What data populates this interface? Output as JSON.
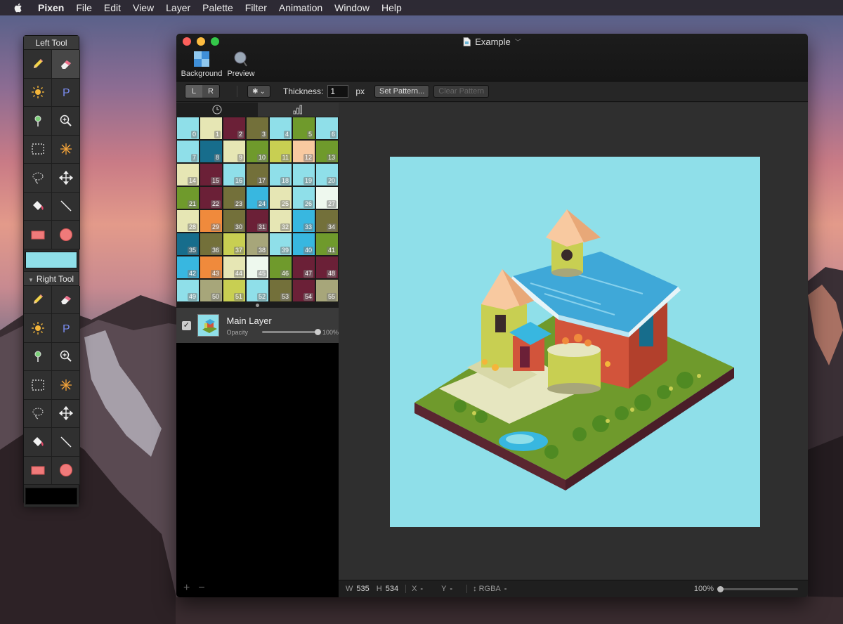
{
  "menubar": {
    "app_name": "Pixen",
    "items": [
      "File",
      "Edit",
      "View",
      "Layer",
      "Palette",
      "Filter",
      "Animation",
      "Window",
      "Help"
    ]
  },
  "tool_panel": {
    "left_title": "Left Tool",
    "right_title": "Right Tool",
    "tools": [
      "pencil-icon",
      "eraser-icon",
      "sun-icon",
      "p-letter-icon",
      "eyedropper-icon",
      "zoom-icon",
      "rect-select-icon",
      "magic-wand-icon",
      "lasso-icon",
      "move-icon",
      "fill-bucket-icon",
      "line-icon",
      "rectangle-icon",
      "ellipse-icon"
    ],
    "left_color": "#8fdfe9",
    "right_color": "#000000"
  },
  "window": {
    "title": "Example",
    "toolbar": {
      "background_label": "Background",
      "preview_label": "Preview"
    },
    "options": {
      "seg_left": "L",
      "seg_right": "R",
      "thickness_label": "Thickness:",
      "thickness_value": "1",
      "thickness_unit": "px",
      "set_pattern": "Set Pattern...",
      "clear_pattern": "Clear Pattern"
    }
  },
  "palette": {
    "colors": [
      "#8fdfe9",
      "#e6e6b4",
      "#6b2037",
      "#73703a",
      "#8fdfe9",
      "#6f9a2c",
      "#8fdfe9",
      "#8fdfe9",
      "#176d8c",
      "#e6e6b4",
      "#6f9a2c",
      "#c8cf52",
      "#f8c9a0",
      "#6f9a2c",
      "#e6e6b4",
      "#6b2037",
      "#8fdfe9",
      "#73703a",
      "#8fdfe9",
      "#8fdfe9",
      "#8fdfe9",
      "#6f9a2c",
      "#6b2037",
      "#73703a",
      "#38b7e0",
      "#e6e6b4",
      "#8fdfe9",
      "#eef8ee",
      "#e6e6b4",
      "#f08a3c",
      "#73703a",
      "#6b2037",
      "#e6e6b4",
      "#38b7e0",
      "#73703a",
      "#176d8c",
      "#73703a",
      "#c8cf52",
      "#a7a67a",
      "#8fdfe9",
      "#38b7e0",
      "#6f9a2c",
      "#38b7e0",
      "#f08a3c",
      "#e6e6b4",
      "#eef8ee",
      "#6f9a2c",
      "#6b2037",
      "#6b2037",
      "#8fdfe9",
      "#a7a67a",
      "#c8cf52",
      "#8fdfe9",
      "#73703a",
      "#6b2037",
      "#a7a67a"
    ],
    "labels": [
      "0",
      "1",
      "2",
      "3",
      "4",
      "5",
      "6",
      "7",
      "8",
      "9",
      "10",
      "11",
      "12",
      "13",
      "14",
      "15",
      "16",
      "17",
      "18",
      "19",
      "20",
      "21",
      "22",
      "23",
      "24",
      "25",
      "26",
      "27",
      "28",
      "29",
      "30",
      "31",
      "32",
      "33",
      "34",
      "35",
      "36",
      "37",
      "38",
      "39",
      "40",
      "41",
      "42",
      "43",
      "44",
      "45",
      "46",
      "47",
      "48",
      "49",
      "50",
      "51",
      "52",
      "53",
      "54",
      "55"
    ]
  },
  "layers": [
    {
      "name": "Main Layer",
      "opacity_label": "Opacity",
      "opacity_value": "100%",
      "visible": true
    }
  ],
  "layer_buttons": {
    "add": "+",
    "remove": "−"
  },
  "canvas": {
    "background": "#8fdfe9"
  },
  "statusbar": {
    "w_label": "W",
    "w_value": "535",
    "h_label": "H",
    "h_value": "534",
    "x_label": "X",
    "x_value": "-",
    "y_label": "Y",
    "y_value": "-",
    "rgba_label": "RGBA",
    "rgba_value": "-",
    "zoom_value": "100%"
  }
}
